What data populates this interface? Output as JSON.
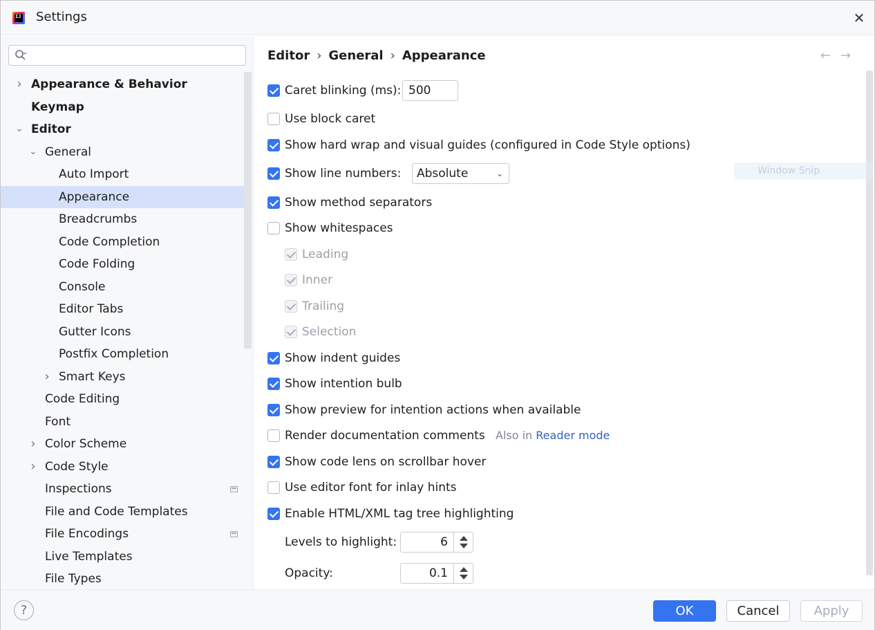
{
  "window": {
    "title": "Settings"
  },
  "search": {
    "placeholder": "",
    "value": ""
  },
  "tree": [
    {
      "label": "Appearance & Behavior",
      "expandable": true,
      "expanded": false,
      "bold": true
    },
    {
      "label": "Keymap",
      "bold": true
    },
    {
      "label": "Editor",
      "expandable": true,
      "expanded": true,
      "bold": true
    },
    {
      "label": "General",
      "expandable": true,
      "expanded": true
    },
    {
      "label": "Auto Import"
    },
    {
      "label": "Appearance",
      "selected": true
    },
    {
      "label": "Breadcrumbs"
    },
    {
      "label": "Code Completion"
    },
    {
      "label": "Code Folding"
    },
    {
      "label": "Console"
    },
    {
      "label": "Editor Tabs"
    },
    {
      "label": "Gutter Icons"
    },
    {
      "label": "Postfix Completion"
    },
    {
      "label": "Smart Keys",
      "expandable": true,
      "expanded": false
    },
    {
      "label": "Code Editing"
    },
    {
      "label": "Font"
    },
    {
      "label": "Color Scheme",
      "expandable": true,
      "expanded": false
    },
    {
      "label": "Code Style",
      "expandable": true,
      "expanded": false
    },
    {
      "label": "Inspections",
      "icon": "project-settings-icon"
    },
    {
      "label": "File and Code Templates"
    },
    {
      "label": "File Encodings",
      "icon": "project-settings-icon"
    },
    {
      "label": "Live Templates"
    },
    {
      "label": "File Types"
    }
  ],
  "breadcrumb": [
    "Editor",
    "General",
    "Appearance"
  ],
  "breadcrumb_separator": "›",
  "nav": {
    "back": "←",
    "forward": "→"
  },
  "options": {
    "caret_blinking": {
      "label": "Caret blinking (ms):",
      "checked": true,
      "value": "500"
    },
    "block_caret": {
      "label": "Use block caret",
      "checked": false
    },
    "hard_wrap": {
      "label": "Show hard wrap and visual guides (configured in Code Style options)",
      "checked": true
    },
    "line_numbers": {
      "label": "Show line numbers:",
      "checked": true,
      "value": "Absolute"
    },
    "method_separators": {
      "label": "Show method separators",
      "checked": true
    },
    "whitespaces": {
      "label": "Show whitespaces",
      "checked": false
    },
    "leading": {
      "label": "Leading",
      "checked": true,
      "disabled": true
    },
    "inner": {
      "label": "Inner",
      "checked": true,
      "disabled": true
    },
    "trailing": {
      "label": "Trailing",
      "checked": true,
      "disabled": true
    },
    "selection": {
      "label": "Selection",
      "checked": true,
      "disabled": true
    },
    "indent_guides": {
      "label": "Show indent guides",
      "checked": true
    },
    "intention_bulb": {
      "label": "Show intention bulb",
      "checked": true
    },
    "preview_intention": {
      "label": "Show preview for intention actions when available",
      "checked": true
    },
    "render_docs": {
      "label": "Render documentation comments",
      "checked": false,
      "hint": "Also in",
      "hint_link": "Reader mode"
    },
    "code_lens": {
      "label": "Show code lens on scrollbar hover",
      "checked": true
    },
    "editor_font_hints": {
      "label": "Use editor font for inlay hints",
      "checked": false
    },
    "tag_tree": {
      "label": "Enable HTML/XML tag tree highlighting",
      "checked": true
    },
    "levels": {
      "label": "Levels to highlight:",
      "value": "6"
    },
    "opacity": {
      "label": "Opacity:",
      "value": "0.1"
    }
  },
  "overlay": {
    "watermark": "Window Snip"
  },
  "footer": {
    "help": "?",
    "ok": "OK",
    "cancel": "Cancel",
    "apply": "Apply"
  },
  "colors": {
    "accent": "#3574f0",
    "selection": "#d5e1fb",
    "link": "#2e62c6"
  }
}
